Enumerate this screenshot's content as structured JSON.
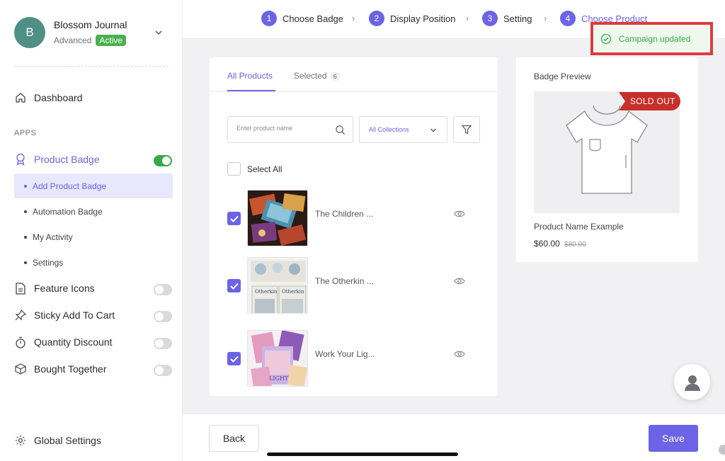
{
  "store": {
    "initial": "B",
    "name": "Blossom Journal",
    "plan": "Advanced",
    "status": "Active"
  },
  "sidebar": {
    "dashboard": "Dashboard",
    "apps_label": "APPS",
    "product_badge": {
      "label": "Product Badge",
      "enabled": true
    },
    "sub_items": [
      "Add Product Badge",
      "Automation Badge",
      "My Activity",
      "Settings"
    ],
    "apps": [
      {
        "label": "Feature Icons",
        "enabled": false
      },
      {
        "label": "Sticky Add To Cart",
        "enabled": false
      },
      {
        "label": "Quantity Discount",
        "enabled": false
      },
      {
        "label": "Bought Together",
        "enabled": false
      }
    ],
    "global_settings": "Global Settings"
  },
  "stepper": {
    "steps": [
      {
        "num": "1",
        "label": "Choose Badge"
      },
      {
        "num": "2",
        "label": "Display Position"
      },
      {
        "num": "3",
        "label": "Setting"
      },
      {
        "num": "4",
        "label": "Choose Product"
      }
    ],
    "separator": "›"
  },
  "toast": {
    "message": "Campaign updated"
  },
  "products": {
    "tabs": {
      "all": "All Products",
      "selected": "Selected",
      "selected_count": "6"
    },
    "search_placeholder": "Enter product name",
    "collection_filter": "All Collections",
    "select_all": "Select All",
    "items": [
      {
        "name": "The Children ...",
        "checked": true
      },
      {
        "name": "The Otherkin ...",
        "checked": true
      },
      {
        "name": "Work Your Lig...",
        "checked": true
      }
    ]
  },
  "preview": {
    "title": "Badge Preview",
    "badge_text": "SOLD OUT",
    "product_name": "Product Name Example",
    "price": "$60.00",
    "compare_price": "$80.00"
  },
  "footer": {
    "back": "Back",
    "save": "Save"
  },
  "colors": {
    "accent": "#6c63e6",
    "success": "#3aa84a",
    "badge_red": "#c7302a",
    "toast_border": "#e03a3e"
  }
}
